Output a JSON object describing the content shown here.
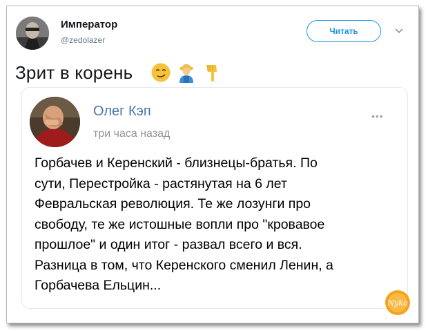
{
  "author": {
    "name": "Император",
    "handle": "@zedolazer"
  },
  "follow_label": "Читать",
  "tweet": {
    "text": "Зрит в корень",
    "emojis": [
      "smirking-face-icon",
      "man-farmer-icon",
      "pointing-down-icon"
    ]
  },
  "quote": {
    "name": "Олег Кэп",
    "time": "три часа назад",
    "menu": "•••",
    "lines": [
      "Горбачев и Керенский - близнецы-братья. По",
      "сути, Перестройка - растянутая на 6 лет",
      "Февральская революция. Те же лозунги про",
      "свободу, те же истошные вопли про \"кровавое",
      "прошлое\" и один итог - развал всего и вся.",
      "Разница в том, что Керенского сменил Ленин, а",
      "Горбачева Ельцин..."
    ]
  },
  "watermark_text": "Nyka",
  "colors": {
    "accent": "#1b95e0",
    "quote_name": "#4a76a8",
    "watermark": "#f39c12"
  }
}
